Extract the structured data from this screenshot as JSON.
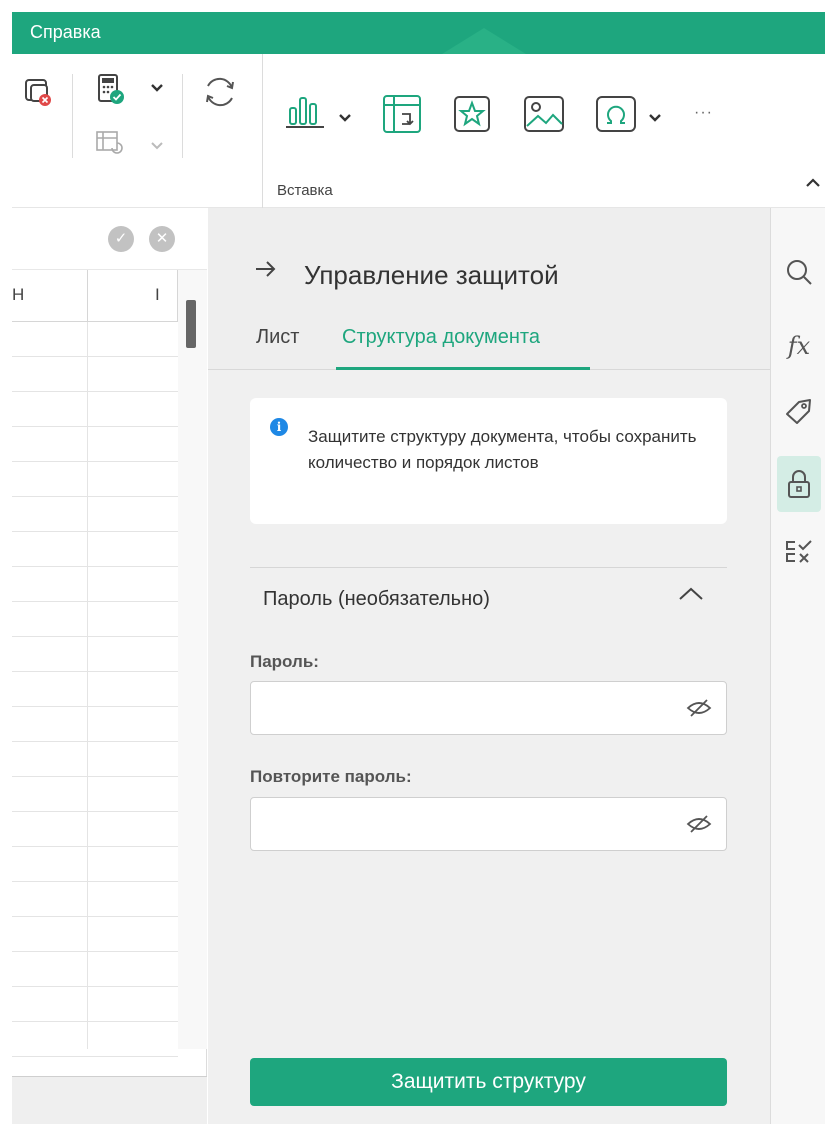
{
  "topbar": {
    "tab_label": "Справка"
  },
  "ribbon": {
    "section_label": "Вставка",
    "tools": [
      {
        "name": "protect-sheet-remove-icon"
      },
      {
        "name": "calc-options-icon"
      },
      {
        "name": "recalc-sheet-icon"
      },
      {
        "name": "refresh-icon"
      },
      {
        "name": "chart-icon"
      },
      {
        "name": "pivot-table-icon"
      },
      {
        "name": "shape-star-icon"
      },
      {
        "name": "image-icon"
      },
      {
        "name": "symbol-omega-icon"
      },
      {
        "name": "more-icon"
      }
    ],
    "more_label": "···"
  },
  "sheet": {
    "columns": [
      "H",
      "I"
    ],
    "row_count": 21
  },
  "panel": {
    "title": "Управление защитой",
    "tabs": [
      {
        "label": "Лист",
        "active": false
      },
      {
        "label": "Структура документа",
        "active": true
      }
    ],
    "info_text": "Защитите структуру документа, чтобы сохранить количество и порядок листов",
    "password_section": {
      "heading": "Пароль (необязательно)",
      "expanded": true,
      "password_label": "Пароль:",
      "password_value": "",
      "repeat_label": "Повторите пароль:",
      "repeat_value": ""
    },
    "submit_label": "Защитить структуру"
  },
  "rail": {
    "items": [
      {
        "name": "search-icon",
        "active": false
      },
      {
        "name": "function-icon",
        "active": false,
        "label": "fx"
      },
      {
        "name": "tag-icon",
        "active": false
      },
      {
        "name": "lock-icon",
        "active": true
      },
      {
        "name": "checklist-icon",
        "active": false
      }
    ]
  },
  "colors": {
    "accent": "#1ea67e",
    "active_rail_bg": "#d4ede5",
    "info_blue": "#1e88e5"
  }
}
